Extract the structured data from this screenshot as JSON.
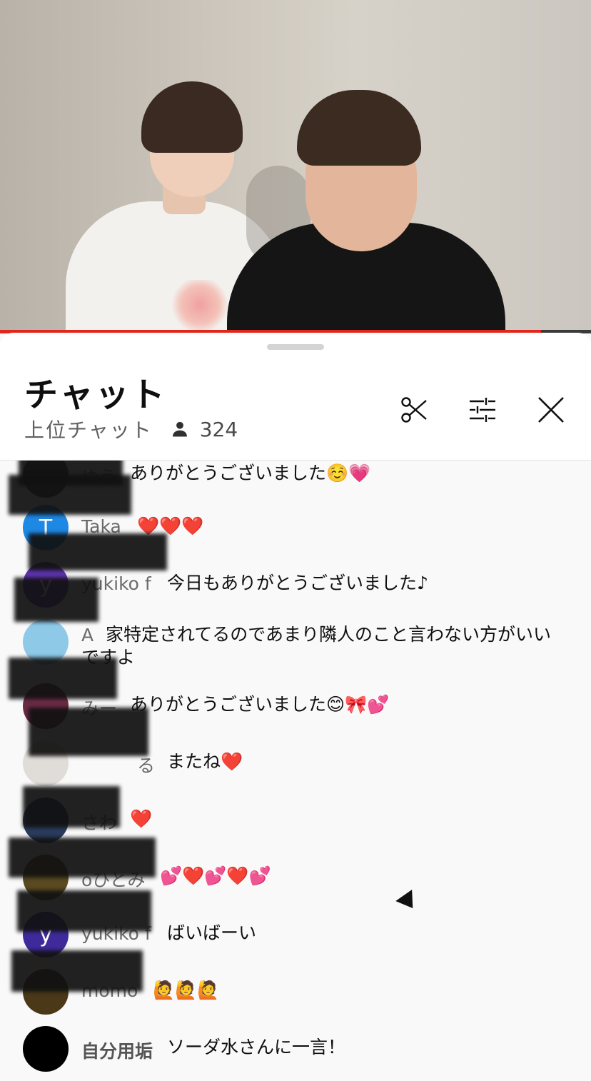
{
  "video": {
    "progress_fraction": 0.915,
    "progress_color": "#e1261c"
  },
  "chat": {
    "title": "チャット",
    "mode": "上位チャット",
    "viewer_count": "324",
    "icons": {
      "viewer": "person-icon",
      "clip": "scissors-icon",
      "filter": "tune-icon",
      "close": "close-icon"
    }
  },
  "messages": [
    {
      "author": "ゆう",
      "text": "ありがとうございました☺️💗",
      "avatar_letter": "",
      "avatar_color": "#3b3b3b"
    },
    {
      "author": "Taka",
      "text": "❤️❤️❤️",
      "avatar_letter": "T",
      "avatar_color": "#1e88e5"
    },
    {
      "author": "yukiko f",
      "text": "今日もありがとうございました♪",
      "avatar_letter": "y",
      "avatar_color": "#5e35b1"
    },
    {
      "author": "A",
      "text": "家特定されてるのであまり隣人のこと言わない方がいいですよ",
      "avatar_letter": "",
      "avatar_color": "#8ec9e8"
    },
    {
      "author": "みー",
      "text": "ありがとうございました😊🎀💕",
      "avatar_letter": "",
      "avatar_color": "#6b2a44"
    },
    {
      "author": "る",
      "text": "またね❤️",
      "avatar_letter": "",
      "avatar_color": "#e0dcd8"
    },
    {
      "author": "さわ",
      "text": "❤️",
      "avatar_letter": "",
      "avatar_color": "#2a3b5c"
    },
    {
      "author": "oひとみ",
      "text": "💕❤️💕❤️💕",
      "avatar_letter": "",
      "avatar_color": "#5a4a20"
    },
    {
      "author": "yukiko f",
      "text": "ばいばーい",
      "avatar_letter": "y",
      "avatar_color": "#3f2a9c"
    },
    {
      "author": "momo",
      "text": "🙋🙋🙋",
      "avatar_letter": "",
      "avatar_color": "#4a3818"
    },
    {
      "author": "自分用垢",
      "text": "ソーダ水さんに一言！",
      "avatar_letter": "",
      "avatar_color": "#000000"
    }
  ]
}
